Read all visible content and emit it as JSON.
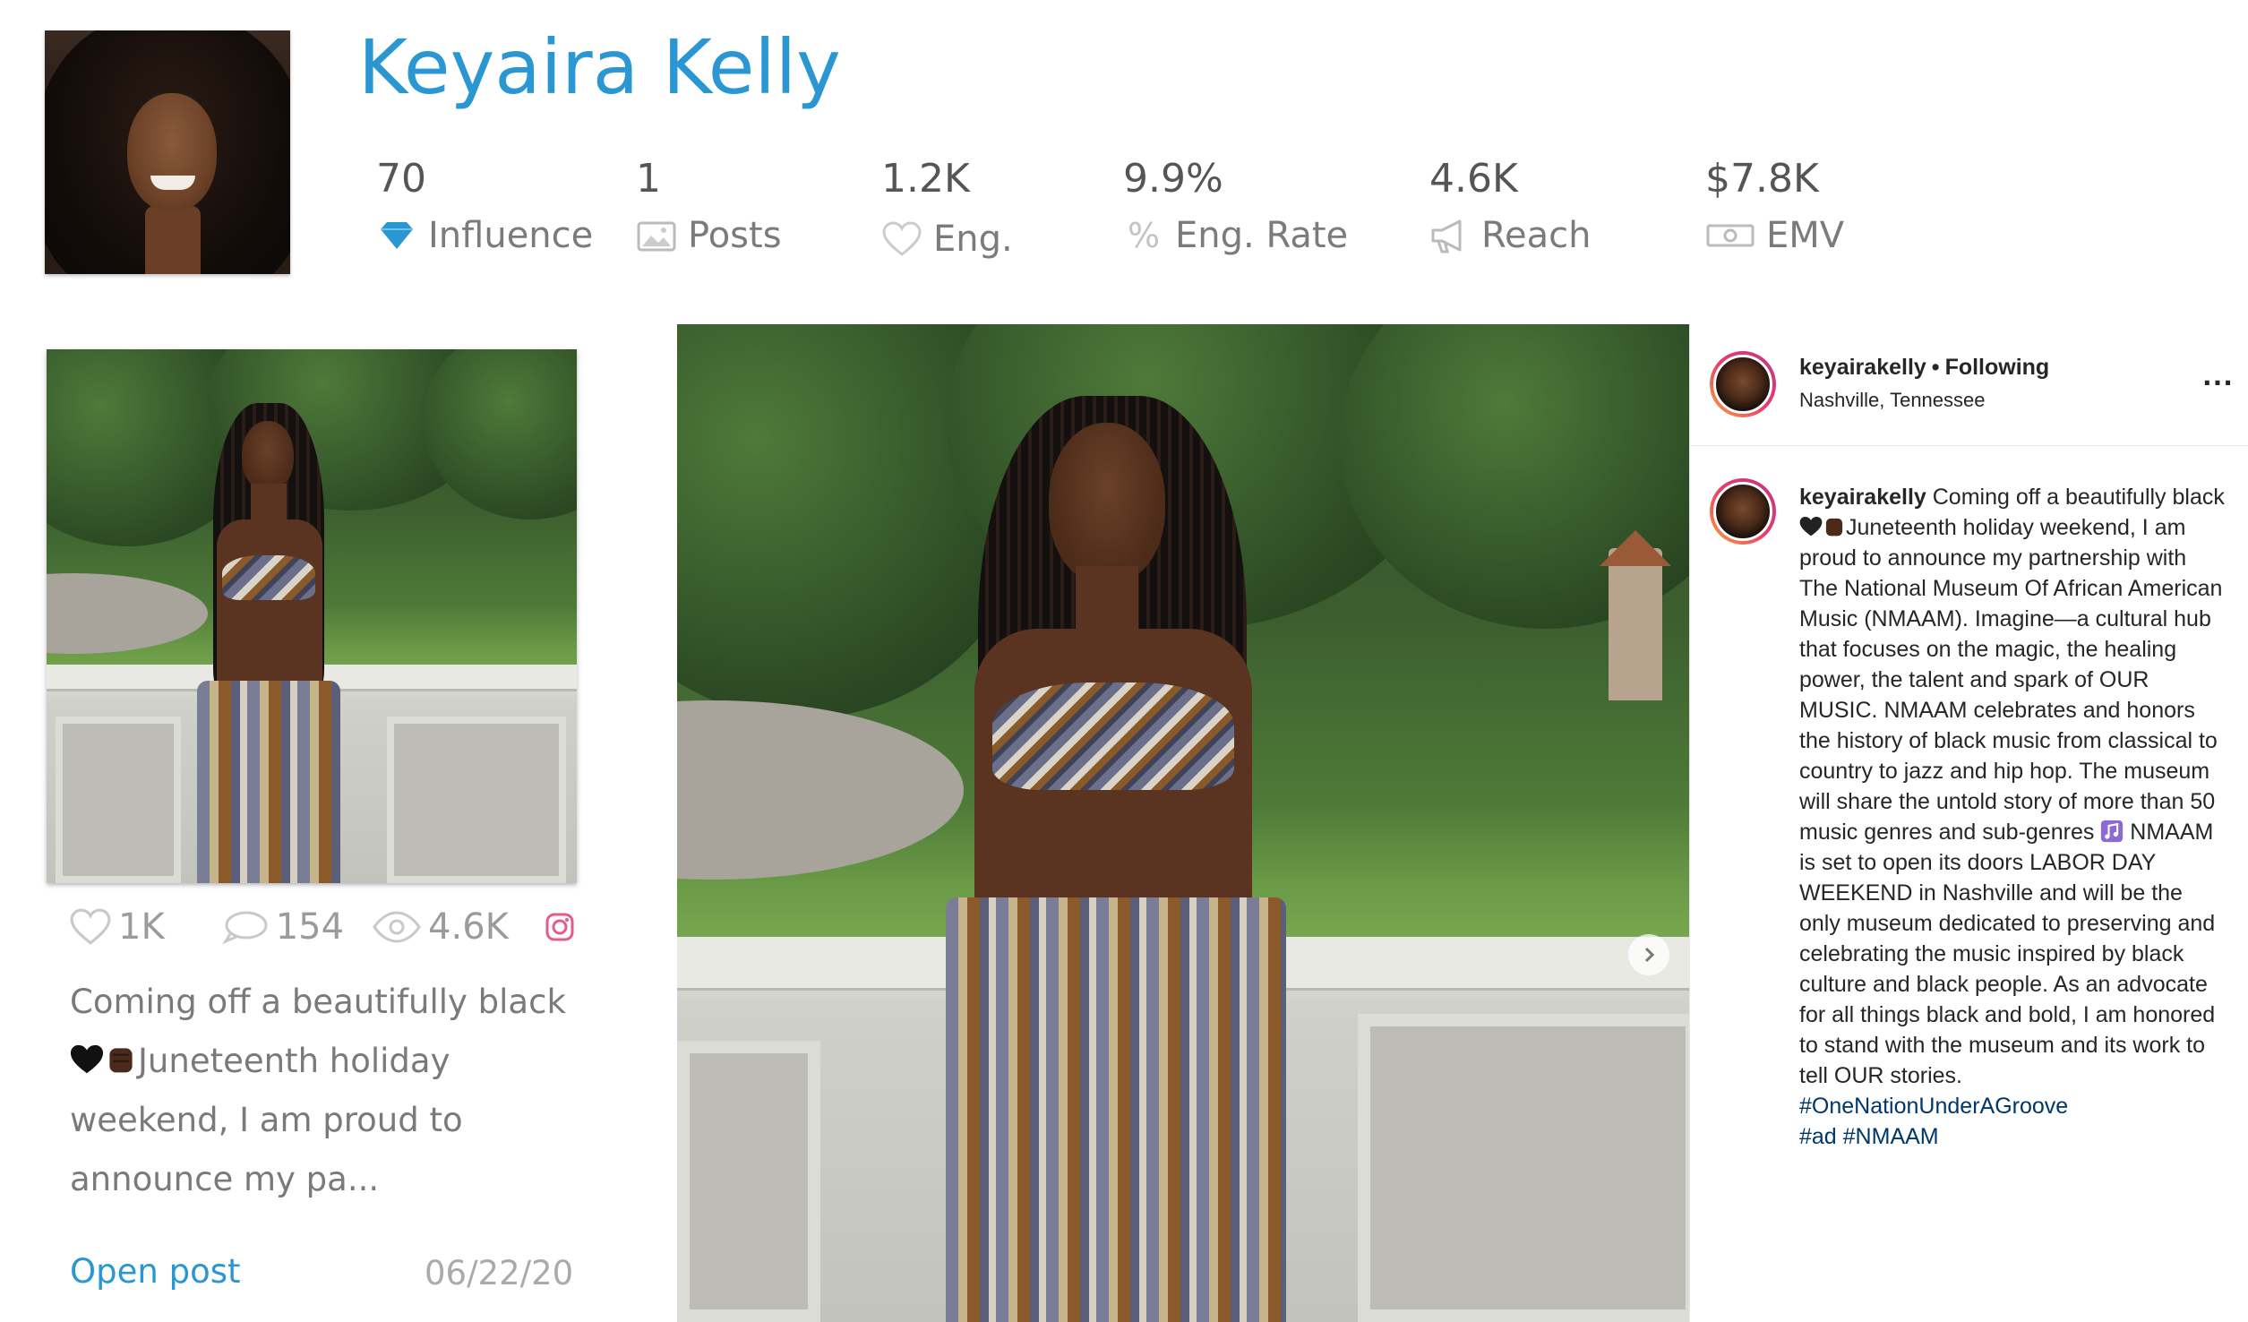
{
  "profile": {
    "name": "Keyaira Kelly"
  },
  "stats": [
    {
      "value": "70",
      "label": "Influence",
      "icon": "diamond-icon"
    },
    {
      "value": "1",
      "label": "Posts",
      "icon": "image-icon"
    },
    {
      "value": "1.2K",
      "label": "Eng.",
      "icon": "heart-icon"
    },
    {
      "value": "9.9%",
      "label": "Eng. Rate",
      "icon": "percent-icon"
    },
    {
      "value": "4.6K",
      "label": "Reach",
      "icon": "megaphone-icon"
    },
    {
      "value": "$7.8K",
      "label": "EMV",
      "icon": "money-icon"
    }
  ],
  "post_card": {
    "likes": "1K",
    "comments": "154",
    "views": "4.6K",
    "platform_icon": "instagram-icon",
    "caption_line1": "Coming off a beautifully black",
    "caption_line2": "Juneteenth holiday",
    "caption_line3": "weekend, I am proud to",
    "caption_line4": "announce my pa...",
    "open_post_label": "Open post",
    "date": "06/22/20"
  },
  "instagram": {
    "username": "keyairakelly",
    "follow_status": "Following",
    "location": "Nashville, Tennessee",
    "more": "...",
    "caption_user": "keyairakelly",
    "caption_a": "Coming off a beautifully black",
    "caption_b": "Juneteenth holiday weekend, I am proud to announce my partnership with The National Museum Of African American Music (NMAAM). Imagine—a cultural hub that focuses on the magic, the healing power, the talent and spark of OUR MUSIC. NMAAM celebrates and honors the history of black music from classical to country to jazz and hip hop. The museum will share the untold story of more than 50 music genres and sub-genres",
    "caption_c": "NMAAM is set to open its doors LABOR DAY WEEKEND in Nashville and will be the only museum dedicated to preserving and celebrating the music inspired by black culture and black people. As an advocate for all things black and bold, I am honored to stand with the museum and its work to tell OUR stories.",
    "hashtags": "#OneNationUnderAGroove",
    "hashtags2": "#ad #NMAAM"
  },
  "colors": {
    "accent": "#2a97d3",
    "text_muted": "#7b7b7b",
    "instagram_link": "#00376b"
  }
}
